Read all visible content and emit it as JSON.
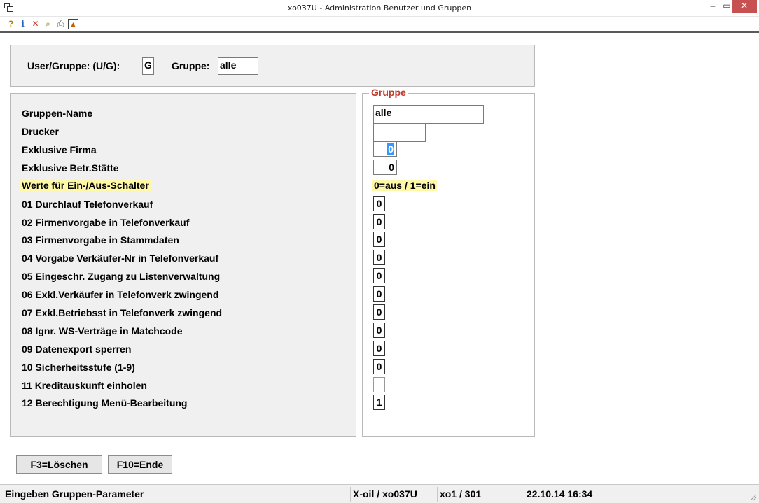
{
  "window": {
    "title": "xo037U - Administration Benutzer und Gruppen",
    "minimize_icon": "minimize-icon",
    "maximize_icon": "maximize-icon",
    "close_icon": "close-icon",
    "minimize_glyph": "–",
    "maximize_glyph": "▭",
    "close_glyph": "✕"
  },
  "toolbar": {
    "items": [
      {
        "icon": "help-icon",
        "glyph": "?"
      },
      {
        "icon": "info-icon",
        "glyph": "ℹ"
      },
      {
        "icon": "delete-icon",
        "glyph": "✕"
      },
      {
        "icon": "search-icon",
        "glyph": "⌕"
      },
      {
        "icon": "print-icon",
        "glyph": "⎙"
      },
      {
        "icon": "export-icon",
        "glyph": "▲"
      }
    ]
  },
  "header": {
    "user_group_label": "User/Gruppe: (U/G):",
    "user_group_value": "G",
    "group_label": "Gruppe:",
    "group_value": "alle"
  },
  "group_box": {
    "legend": "Gruppe",
    "switch_note": "0=aus / 1=ein"
  },
  "fields": {
    "group_name_label": "Gruppen-Name",
    "group_name_value": "alle",
    "printer_label": "Drucker",
    "printer_value": "",
    "exclusive_company_label": "Exklusive Firma",
    "exclusive_company_value": "0",
    "exclusive_site_label": "Exklusive Betr.Stätte",
    "exclusive_site_value": "0",
    "switch_values_label": "Werte für Ein-/Aus-Schalter"
  },
  "switches": [
    {
      "label": "01 Durchlauf Telefonverkauf",
      "value": "0"
    },
    {
      "label": "02 Firmenvorgabe in Telefonverkauf",
      "value": "0"
    },
    {
      "label": "03 Firmenvorgabe in Stammdaten",
      "value": "0"
    },
    {
      "label": "04 Vorgabe Verkäufer-Nr in Telefonverkauf",
      "value": "0"
    },
    {
      "label": "05 Eingeschr. Zugang zu Listenverwaltung",
      "value": "0"
    },
    {
      "label": "06 Exkl.Verkäufer in Telefonverk zwingend",
      "value": "0"
    },
    {
      "label": "07 Exkl.Betriebsst in Telefonverk zwingend",
      "value": "0"
    },
    {
      "label": "08 Ignr. WS-Verträge in Matchcode",
      "value": "0"
    },
    {
      "label": "09 Datenexport sperren",
      "value": "0"
    },
    {
      "label": "10 Sicherheitsstufe (1-9)",
      "value": "0"
    },
    {
      "label": "11 Kreditauskunft einholen",
      "value": ""
    },
    {
      "label": "12 Berechtigung Menü-Bearbeitung",
      "value": "1"
    }
  ],
  "buttons": {
    "delete_label": "F3=Löschen",
    "end_label": "F10=Ende"
  },
  "status": {
    "message": "Eingeben Gruppen-Parameter",
    "program": "X-oil / xo037U",
    "session": "xo1 / 301",
    "datetime": "22.10.14 16:34"
  }
}
